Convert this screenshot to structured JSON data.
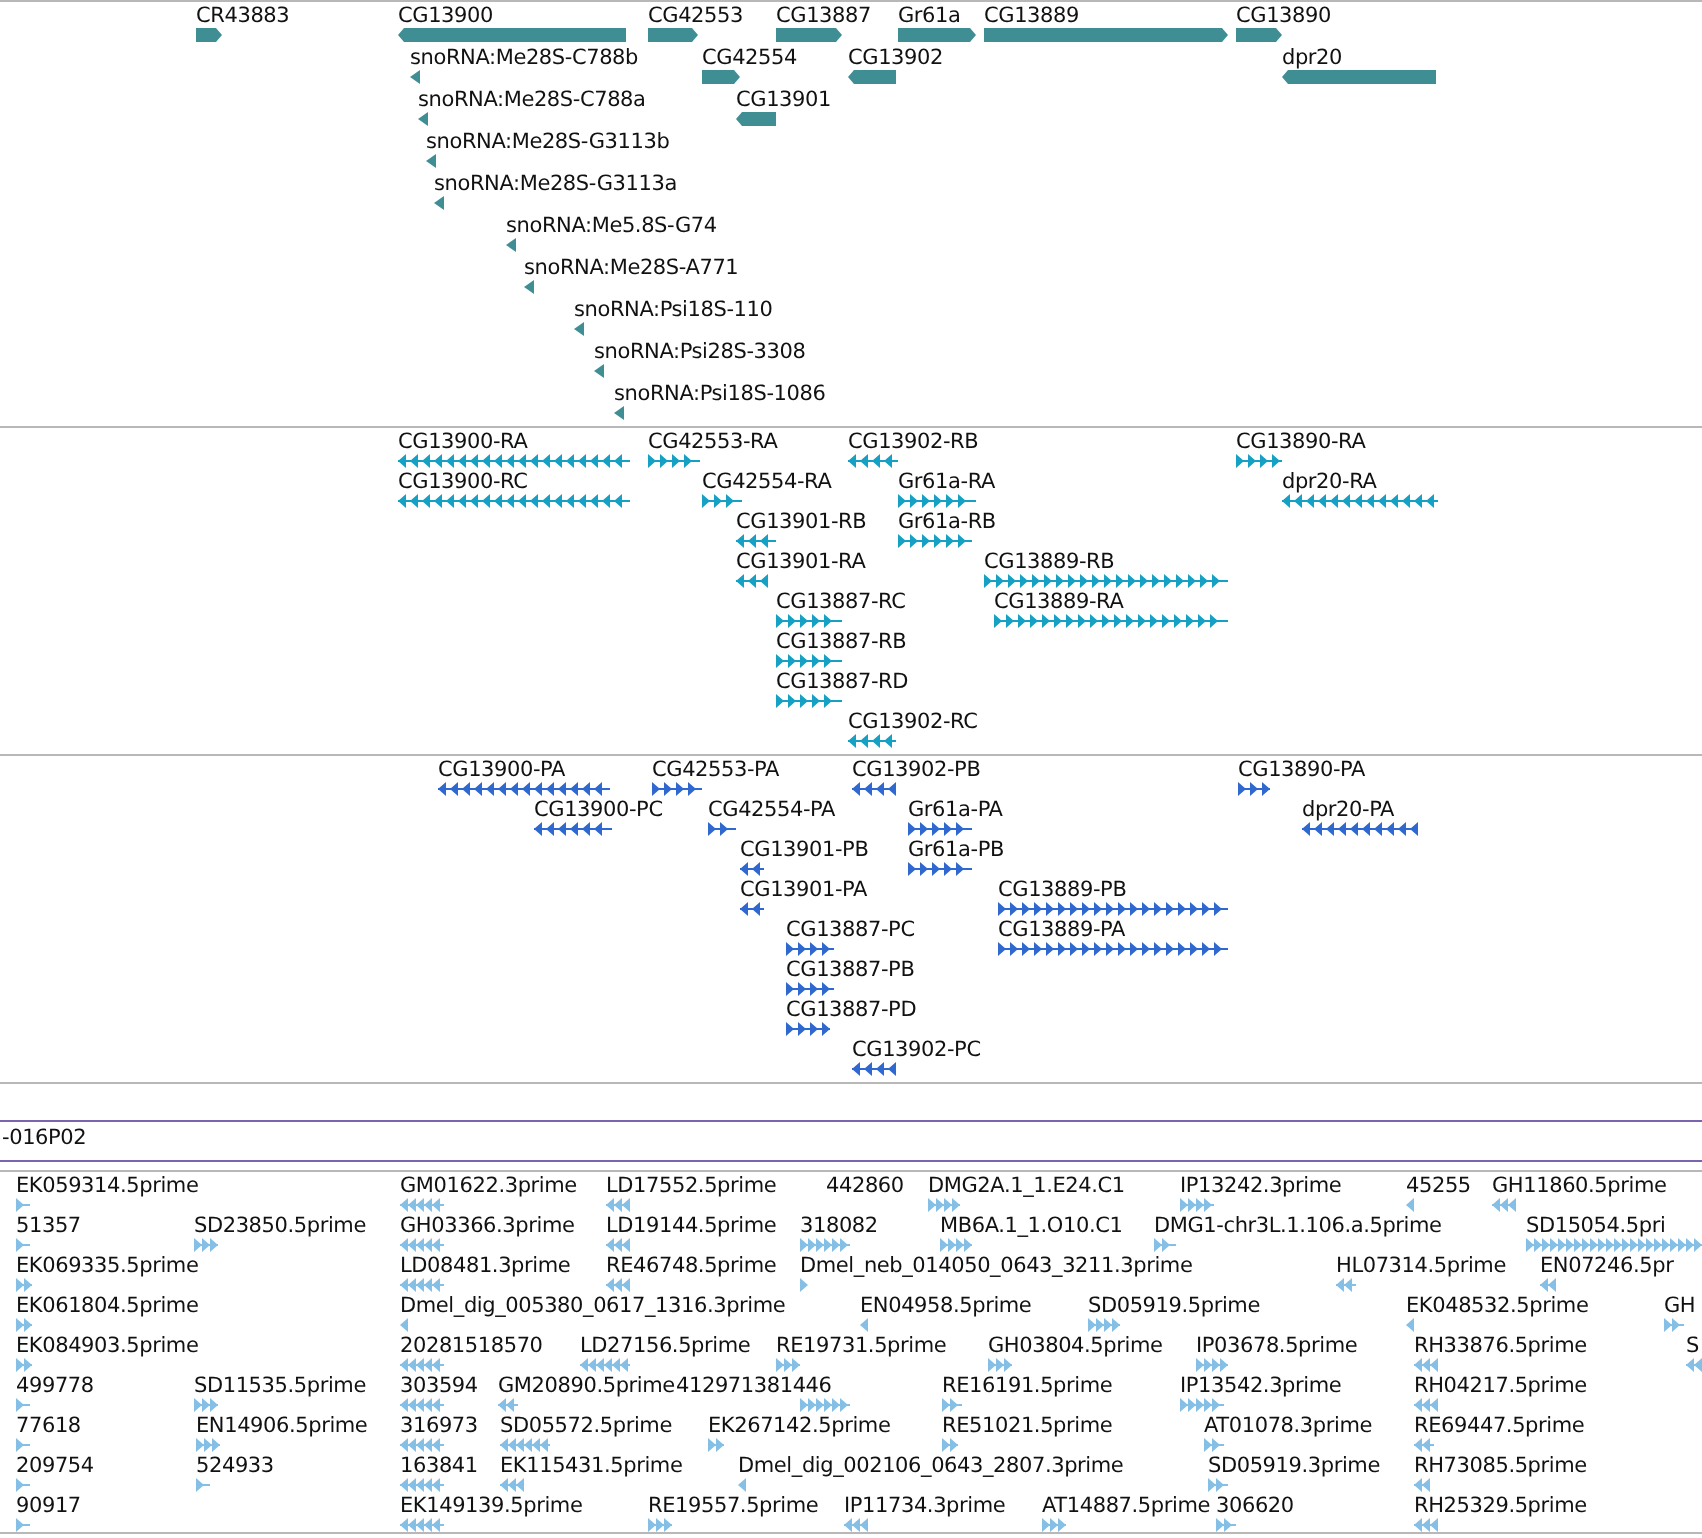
{
  "tracks": [
    {
      "kind": "gene",
      "color": "#3e8e94",
      "features": [
        {
          "label": "CR43883",
          "reverse": false
        },
        {
          "label": "CG13900",
          "reverse": true
        },
        {
          "label": "CG42553",
          "reverse": false
        },
        {
          "label": "CG13887",
          "reverse": false
        },
        {
          "label": "Gr61a",
          "reverse": false
        },
        {
          "label": "CG13889",
          "reverse": false
        },
        {
          "label": "CG13890",
          "reverse": false
        },
        {
          "label": "snoRNA:Me28S-C788b",
          "reverse": true
        },
        {
          "label": "CG42554",
          "reverse": false
        },
        {
          "label": "CG13902",
          "reverse": true
        },
        {
          "label": "dpr20",
          "reverse": true
        },
        {
          "label": "snoRNA:Me28S-C788a",
          "reverse": true
        },
        {
          "label": "CG13901",
          "reverse": true
        },
        {
          "label": "snoRNA:Me28S-G3113b",
          "reverse": true
        },
        {
          "label": "snoRNA:Me28S-G3113a",
          "reverse": true
        },
        {
          "label": "snoRNA:Me5.8S-G74",
          "reverse": true
        },
        {
          "label": "snoRNA:Me28S-A771",
          "reverse": true
        },
        {
          "label": "snoRNA:Psi18S-110",
          "reverse": true
        },
        {
          "label": "snoRNA:Psi28S-3308",
          "reverse": true
        },
        {
          "label": "snoRNA:Psi18S-1086",
          "reverse": true
        }
      ]
    },
    {
      "kind": "transcript",
      "color": "#16a0c4",
      "features": [
        {
          "label": "CG13900-RA",
          "reverse": true
        },
        {
          "label": "CG42553-RA",
          "reverse": false
        },
        {
          "label": "CG13902-RB",
          "reverse": true
        },
        {
          "label": "CG13890-RA",
          "reverse": false
        },
        {
          "label": "CG13900-RC",
          "reverse": true
        },
        {
          "label": "CG42554-RA",
          "reverse": false
        },
        {
          "label": "Gr61a-RA",
          "reverse": false
        },
        {
          "label": "dpr20-RA",
          "reverse": true
        },
        {
          "label": "CG13901-RB",
          "reverse": true
        },
        {
          "label": "Gr61a-RB",
          "reverse": false
        },
        {
          "label": "CG13901-RA",
          "reverse": true
        },
        {
          "label": "CG13889-RB",
          "reverse": false
        },
        {
          "label": "CG13887-RC",
          "reverse": false
        },
        {
          "label": "CG13889-RA",
          "reverse": false
        },
        {
          "label": "CG13887-RB",
          "reverse": false
        },
        {
          "label": "CG13887-RD",
          "reverse": false
        },
        {
          "label": "CG13902-RC",
          "reverse": true
        }
      ]
    },
    {
      "kind": "transcript",
      "color": "#2f68cf",
      "features": [
        {
          "label": "CG13900-PA",
          "reverse": true
        },
        {
          "label": "CG42553-PA",
          "reverse": false
        },
        {
          "label": "CG13902-PB",
          "reverse": true
        },
        {
          "label": "CG13890-PA",
          "reverse": false
        },
        {
          "label": "CG13900-PC",
          "reverse": true
        },
        {
          "label": "CG42554-PA",
          "reverse": false
        },
        {
          "label": "Gr61a-PA",
          "reverse": false
        },
        {
          "label": "dpr20-PA",
          "reverse": true
        },
        {
          "label": "CG13901-PB",
          "reverse": true
        },
        {
          "label": "Gr61a-PB",
          "reverse": false
        },
        {
          "label": "CG13901-PA",
          "reverse": true
        },
        {
          "label": "CG13889-PB",
          "reverse": false
        },
        {
          "label": "CG13887-PC",
          "reverse": false
        },
        {
          "label": "CG13889-PA",
          "reverse": false
        },
        {
          "label": "CG13887-PB",
          "reverse": false
        },
        {
          "label": "CG13887-PD",
          "reverse": false
        },
        {
          "label": "CG13902-PC",
          "reverse": true
        }
      ]
    }
  ],
  "clone_label": "-016P02",
  "est_track": {
    "kind": "est",
    "color": "#86bfe6",
    "features": [
      {
        "label": "EK059314.5prime",
        "reverse": false
      },
      {
        "label": "GM01622.3prime",
        "reverse": true
      },
      {
        "label": "LD17552.5prime",
        "reverse": true
      },
      {
        "label": "442860"
      },
      {
        "label": "DMG2A.1_1.E24.C1",
        "reverse": false
      },
      {
        "label": "IP13242.3prime",
        "reverse": false
      },
      {
        "label": "45255",
        "reverse": true
      },
      {
        "label": "GH11860.5prime",
        "reverse": true
      },
      {
        "label": "51357",
        "reverse": false
      },
      {
        "label": "SD23850.5prime",
        "reverse": false
      },
      {
        "label": "GH03366.3prime",
        "reverse": true
      },
      {
        "label": "LD19144.5prime",
        "reverse": true
      },
      {
        "label": "318082",
        "reverse": false
      },
      {
        "label": "MB6A.1_1.O10.C1",
        "reverse": false
      },
      {
        "label": "DMG1-chr3L.1.106.a.5prime",
        "reverse": false
      },
      {
        "label": "SD15054.5pri",
        "reverse": false
      },
      {
        "label": "EK069335.5prime",
        "reverse": false
      },
      {
        "label": "LD08481.3prime",
        "reverse": true
      },
      {
        "label": "RE46748.5prime",
        "reverse": true
      },
      {
        "label": "Dmel_neb_014050_0643_3211.3prime",
        "reverse": false
      },
      {
        "label": "HL07314.5prime",
        "reverse": true
      },
      {
        "label": "EN07246.5pr",
        "reverse": true
      },
      {
        "label": "EK061804.5prime",
        "reverse": false
      },
      {
        "label": "Dmel_dig_005380_0617_1316.3prime",
        "reverse": true
      },
      {
        "label": "EN04958.5prime",
        "reverse": true
      },
      {
        "label": "SD05919.5prime",
        "reverse": false
      },
      {
        "label": "EK048532.5prime",
        "reverse": true
      },
      {
        "label": "GH",
        "reverse": false
      },
      {
        "label": "EK084903.5prime",
        "reverse": false
      },
      {
        "label": "20281518570",
        "reverse": true
      },
      {
        "label": "LD27156.5prime",
        "reverse": true
      },
      {
        "label": "RE19731.5prime",
        "reverse": false
      },
      {
        "label": "GH03804.5prime",
        "reverse": false
      },
      {
        "label": "IP03678.5prime",
        "reverse": false
      },
      {
        "label": "RH33876.5prime",
        "reverse": true
      },
      {
        "label": "S",
        "reverse": true
      },
      {
        "label": "499778",
        "reverse": false
      },
      {
        "label": "SD11535.5prime",
        "reverse": false
      },
      {
        "label": "303594",
        "reverse": true
      },
      {
        "label": "GM20890.5prime",
        "reverse": true
      },
      {
        "label": "412971381446",
        "reverse": false
      },
      {
        "label": "RE16191.5prime",
        "reverse": false
      },
      {
        "label": "IP13542.3prime",
        "reverse": false
      },
      {
        "label": "RH04217.5prime",
        "reverse": true
      },
      {
        "label": "77618",
        "reverse": false
      },
      {
        "label": "EN14906.5prime",
        "reverse": false
      },
      {
        "label": "316973",
        "reverse": true
      },
      {
        "label": "SD05572.5prime",
        "reverse": true
      },
      {
        "label": "EK267142.5prime",
        "reverse": false
      },
      {
        "label": "RE51021.5prime",
        "reverse": false
      },
      {
        "label": "AT01078.3prime",
        "reverse": false
      },
      {
        "label": "RE69447.5prime",
        "reverse": true
      },
      {
        "label": "209754",
        "reverse": false
      },
      {
        "label": "524933",
        "reverse": false
      },
      {
        "label": "163841",
        "reverse": true
      },
      {
        "label": "EK115431.5prime",
        "reverse": true
      },
      {
        "label": "Dmel_dig_002106_0643_2807.3prime",
        "reverse": true
      },
      {
        "label": "SD05919.3prime",
        "reverse": false
      },
      {
        "label": "RH73085.5prime",
        "reverse": true
      },
      {
        "label": "90917",
        "reverse": false
      },
      {
        "label": "EK149139.5prime",
        "reverse": true
      },
      {
        "label": "RE19557.5prime",
        "reverse": false
      },
      {
        "label": "IP11734.3prime",
        "reverse": true
      },
      {
        "label": "AT14887.5prime",
        "reverse": false
      },
      {
        "label": "306620",
        "reverse": false
      },
      {
        "label": "RH25329.5prime",
        "reverse": true
      }
    ]
  }
}
